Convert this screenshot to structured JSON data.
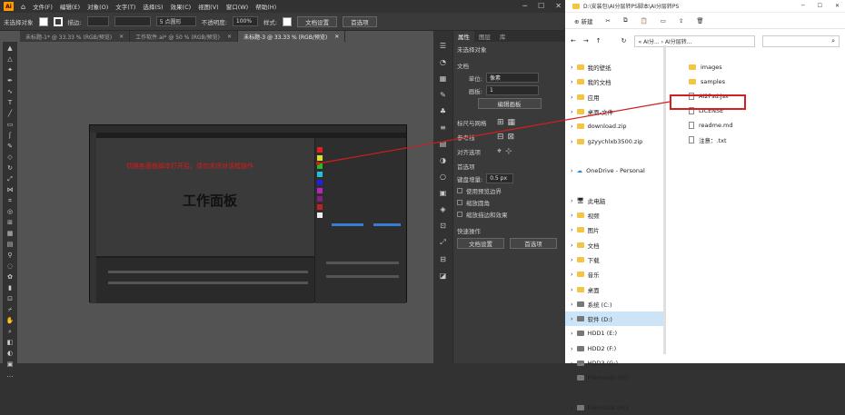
{
  "topbar": {
    "menus": [
      "文件(F)",
      "编辑(E)",
      "对象(O)",
      "文字(T)",
      "选择(S)",
      "效果(C)",
      "视图(V)",
      "窗口(W)",
      "帮助(H)"
    ]
  },
  "controlbar": {
    "selection": "未选择对象",
    "stroke_label": "描边:",
    "point_label": "5 点圆形",
    "opacity_label": "不透明度:",
    "opacity": "100%",
    "style_label": "样式:",
    "doc_setup": "文档设置",
    "prefs": "首选项"
  },
  "tabs": [
    {
      "label": "未标题-1* @ 33.33 % (RGB/预览)"
    },
    {
      "label": "工作软件.ai* @ 50 % (RGB/预览)"
    },
    {
      "label": "未标题-3 @ 33.33 % (RGB/预览)"
    }
  ],
  "artboard": {
    "label": "工作面板",
    "red_text": "切换各面板脚本打开后，请勿关闭对话框操作"
  },
  "right_panel": {
    "tabs": [
      "属性",
      "图层",
      "库"
    ],
    "no_selection": "未选择对象",
    "doc_header": "文档",
    "unit_label": "单位:",
    "unit_value": "像素",
    "artboard_label": "画板:",
    "artboard_value": "1",
    "edit_artboard": "编辑画板",
    "align_header": "标尺与网格",
    "guides_header": "参考线",
    "snap_header": "对齐选项",
    "prefs_header": "首选项",
    "keyboard_inc": "键盘增量:",
    "keyboard_value": "0.5 px",
    "use_preview": "使用预览边界",
    "round_corners": "缩放圆角",
    "scale_strokes": "缩放描边和效果",
    "quick_actions": "快速操作",
    "btn_doc": "文档设置",
    "btn_pref": "首选项"
  },
  "explorer": {
    "title": "D:\\安装包\\AI分层转PS脚本\\AI分层转PS",
    "new_label": "新建",
    "address": "« AI分... › AI分层转...",
    "tree": [
      {
        "label": "我的壁纸",
        "type": "folder"
      },
      {
        "label": "我的文档",
        "type": "folder"
      },
      {
        "label": "应用",
        "type": "folder"
      },
      {
        "label": "桌面-文件",
        "type": "folder"
      },
      {
        "label": "download.zip",
        "type": "folder"
      },
      {
        "label": "gzyychlxb3500.zip",
        "type": "folder"
      },
      {
        "label": "",
        "type": "spacer"
      },
      {
        "label": "OneDrive - Personal",
        "type": "cloud"
      },
      {
        "label": "",
        "type": "spacer"
      },
      {
        "label": "此电脑",
        "type": "pc"
      },
      {
        "label": "视频",
        "type": "folder"
      },
      {
        "label": "图片",
        "type": "folder"
      },
      {
        "label": "文档",
        "type": "folder"
      },
      {
        "label": "下载",
        "type": "folder"
      },
      {
        "label": "音乐",
        "type": "folder"
      },
      {
        "label": "桌面",
        "type": "folder"
      },
      {
        "label": "系统 (C:)",
        "type": "drive"
      },
      {
        "label": "软件 (D:)",
        "type": "drive",
        "selected": true
      },
      {
        "label": "HDD1 (E:)",
        "type": "drive"
      },
      {
        "label": "HDD2 (F:)",
        "type": "drive"
      },
      {
        "label": "HDD3 (G:)",
        "type": "drive"
      },
      {
        "label": "Elements (H:)",
        "type": "drive"
      },
      {
        "label": "",
        "type": "spacer"
      },
      {
        "label": "Elements (H:)",
        "type": "drive"
      }
    ],
    "files": [
      {
        "label": "images",
        "type": "folder"
      },
      {
        "label": "samples",
        "type": "folder"
      },
      {
        "label": "Ai2Psd.jsx",
        "type": "doc"
      },
      {
        "label": "LICENSE",
        "type": "doc"
      },
      {
        "label": "readme.md",
        "type": "doc"
      },
      {
        "label": "注意：.txt",
        "type": "doc"
      }
    ]
  },
  "colors": {
    "accent_red": "#d21f1f",
    "folder": "#f4c542"
  }
}
